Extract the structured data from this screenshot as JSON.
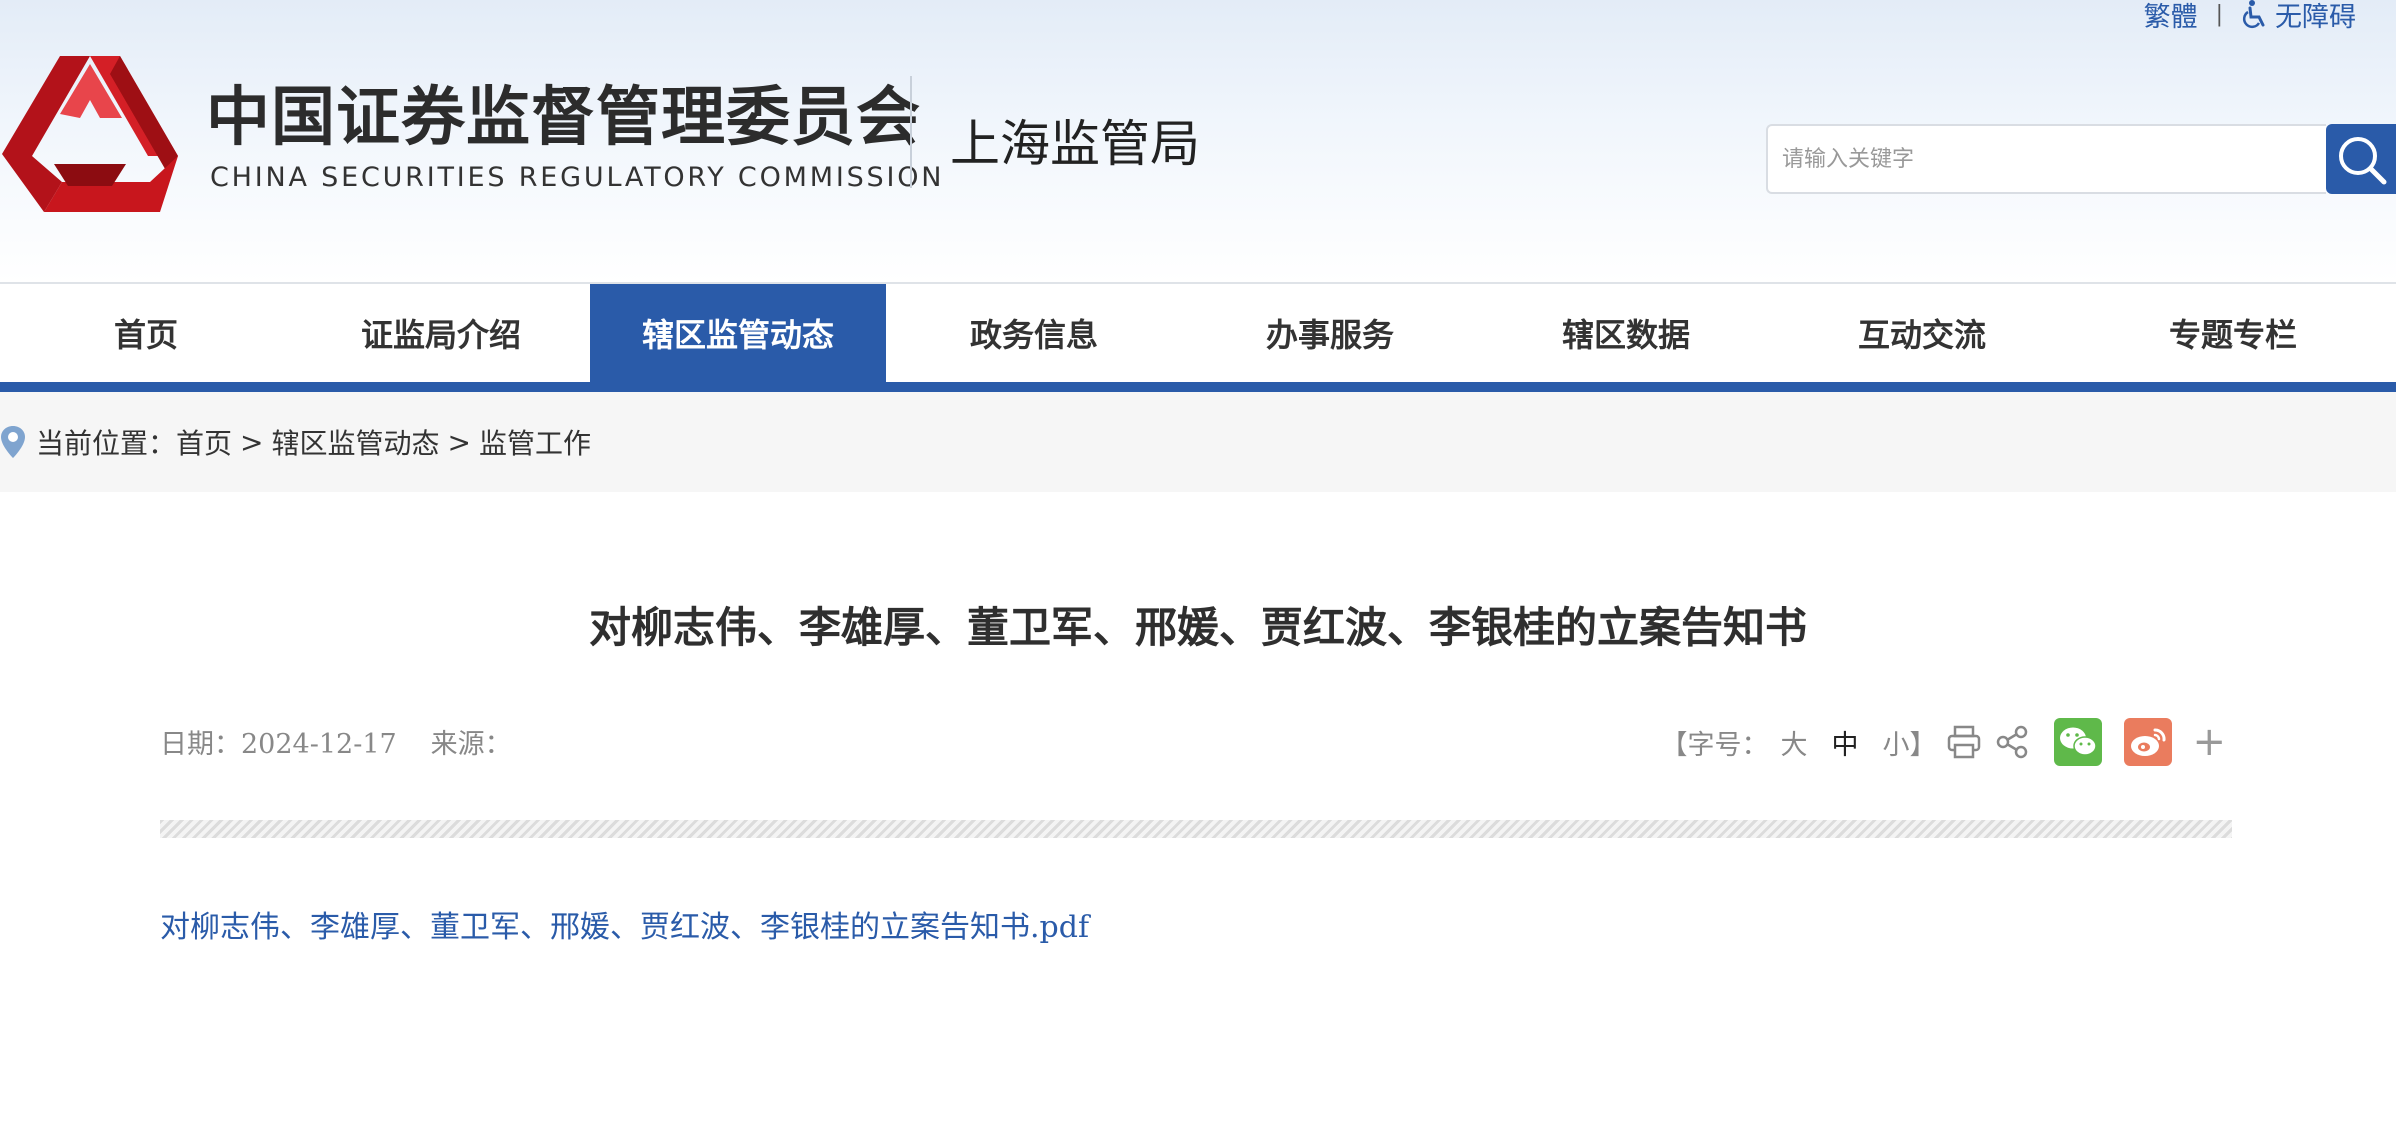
{
  "header": {
    "top_links": {
      "traditional": "繁體",
      "separator": "|",
      "accessibility": "无障碍"
    },
    "logo_cn": "中国证券监督管理委员会",
    "logo_en": "CHINA SECURITIES REGULATORY COMMISSION",
    "bureau": "上海监管局",
    "search": {
      "placeholder": "请输入关键字"
    }
  },
  "nav": {
    "items": [
      {
        "label": "首页"
      },
      {
        "label": "证监局介绍"
      },
      {
        "label": "辖区监管动态"
      },
      {
        "label": "政务信息"
      },
      {
        "label": "办事服务"
      },
      {
        "label": "辖区数据"
      },
      {
        "label": "互动交流"
      },
      {
        "label": "专题专栏"
      }
    ],
    "active_index": 2
  },
  "breadcrumb": {
    "prefix": "当前位置：",
    "items": [
      "首页",
      "辖区监管动态",
      "监管工作"
    ],
    "separator": ">"
  },
  "article": {
    "title": "对柳志伟、李雄厚、董卫军、邢媛、贾红波、李银桂的立案告知书",
    "date_label": "日期：",
    "date": "2024-12-17",
    "source_label": "来源：",
    "font_size": {
      "prefix": "【字号：",
      "large": "大",
      "medium": "中",
      "small": "小",
      "suffix": "】"
    },
    "plus": "+",
    "attachment": "对柳志伟、李雄厚、董卫军、邢媛、贾红波、李银桂的立案告知书.pdf"
  },
  "colors": {
    "brand_blue": "#2a5ba9",
    "logo_red": "#c8161d",
    "wechat_green": "#5fb94a",
    "weibo_orange": "#ea7c5e"
  },
  "icons": [
    "accessibility-icon",
    "search-icon",
    "location-pin-icon",
    "print-icon",
    "share-icon",
    "wechat-icon",
    "weibo-icon"
  ]
}
